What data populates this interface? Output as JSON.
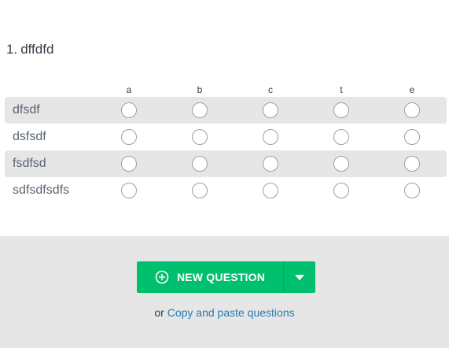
{
  "question": {
    "number": "1.",
    "title": "dffdfd",
    "columns": [
      "a",
      "b",
      "c",
      "t",
      "e"
    ],
    "rows": [
      "dfsdf",
      "dsfsdf",
      "fsdfsd",
      "sdfsdfsdfs"
    ]
  },
  "footer": {
    "new_question_label": "NEW QUESTION",
    "or_text": "or",
    "copy_paste_link": "Copy and paste questions"
  },
  "colors": {
    "primary_green": "#00bf6f",
    "link_blue": "#2a7ab0",
    "row_shade": "#e6e6e6",
    "footer_bg": "#e6e6e6"
  },
  "icons": {
    "new_question": "plus-circle-icon",
    "dropdown": "caret-down-icon"
  }
}
